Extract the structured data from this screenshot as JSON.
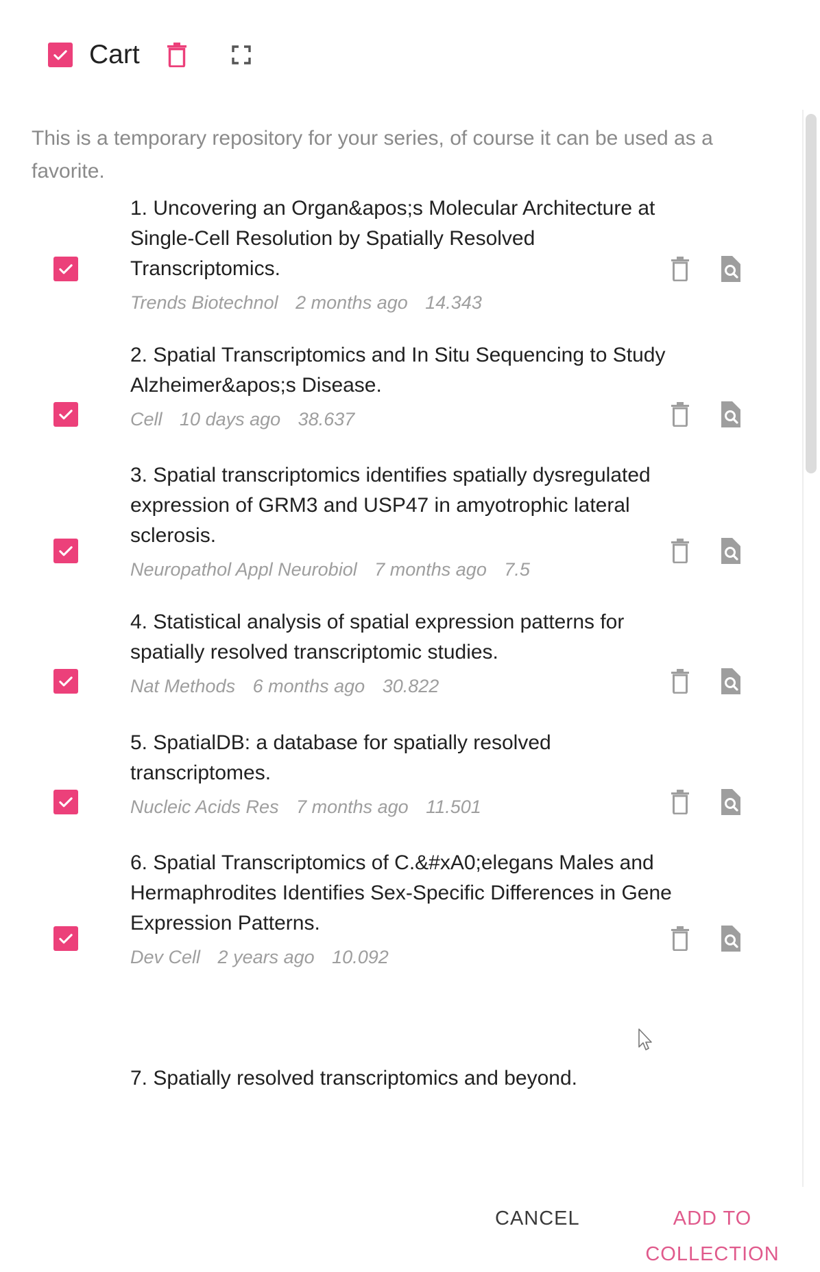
{
  "header": {
    "title": "Cart",
    "accent_color": "#ec407a",
    "icons": [
      "checkbox-checked-icon",
      "trash-icon",
      "fullscreen-icon"
    ]
  },
  "description": "This is a temporary repository for your series, of course it can be used as a favorite.",
  "items": [
    {
      "title": "1. Uncovering an Organ&apos;s Molecular Architecture at Single-Cell Resolution by Spatially Resolved Transcriptomics.",
      "journal": "Trends Biotechnol",
      "time": "2 months ago",
      "score": "14.343",
      "checked": true
    },
    {
      "title": "2. Spatial Transcriptomics and In Situ Sequencing to Study Alzheimer&apos;s Disease.",
      "journal": "Cell",
      "time": "10 days ago",
      "score": "38.637",
      "checked": true
    },
    {
      "title": "3. Spatial transcriptomics identifies spatially dysregulated expression of GRM3 and USP47 in amyotrophic lateral sclerosis.",
      "journal": "Neuropathol Appl Neurobiol",
      "time": "7 months ago",
      "score": "7.5",
      "checked": true
    },
    {
      "title": "4. Statistical analysis of spatial expression patterns for spatially resolved transcriptomic studies.",
      "journal": "Nat Methods",
      "time": "6 months ago",
      "score": "30.822",
      "checked": true
    },
    {
      "title": "5. SpatialDB: a database for spatially resolved transcriptomes.",
      "journal": "Nucleic Acids Res",
      "time": "7 months ago",
      "score": "11.501",
      "checked": true
    },
    {
      "title": "6. Spatial Transcriptomics of C.&#xA0;elegans Males and Hermaphrodites Identifies Sex-Specific Differences in Gene Expression Patterns.",
      "journal": "Dev Cell",
      "time": "2 years ago",
      "score": "10.092",
      "checked": true
    },
    {
      "title": "7. Spatially resolved transcriptomics and beyond.",
      "journal": "",
      "time": "",
      "score": "",
      "checked": true
    }
  ],
  "footer": {
    "cancel_label": "CANCEL",
    "add_label": "ADD TO COLLECTION"
  }
}
